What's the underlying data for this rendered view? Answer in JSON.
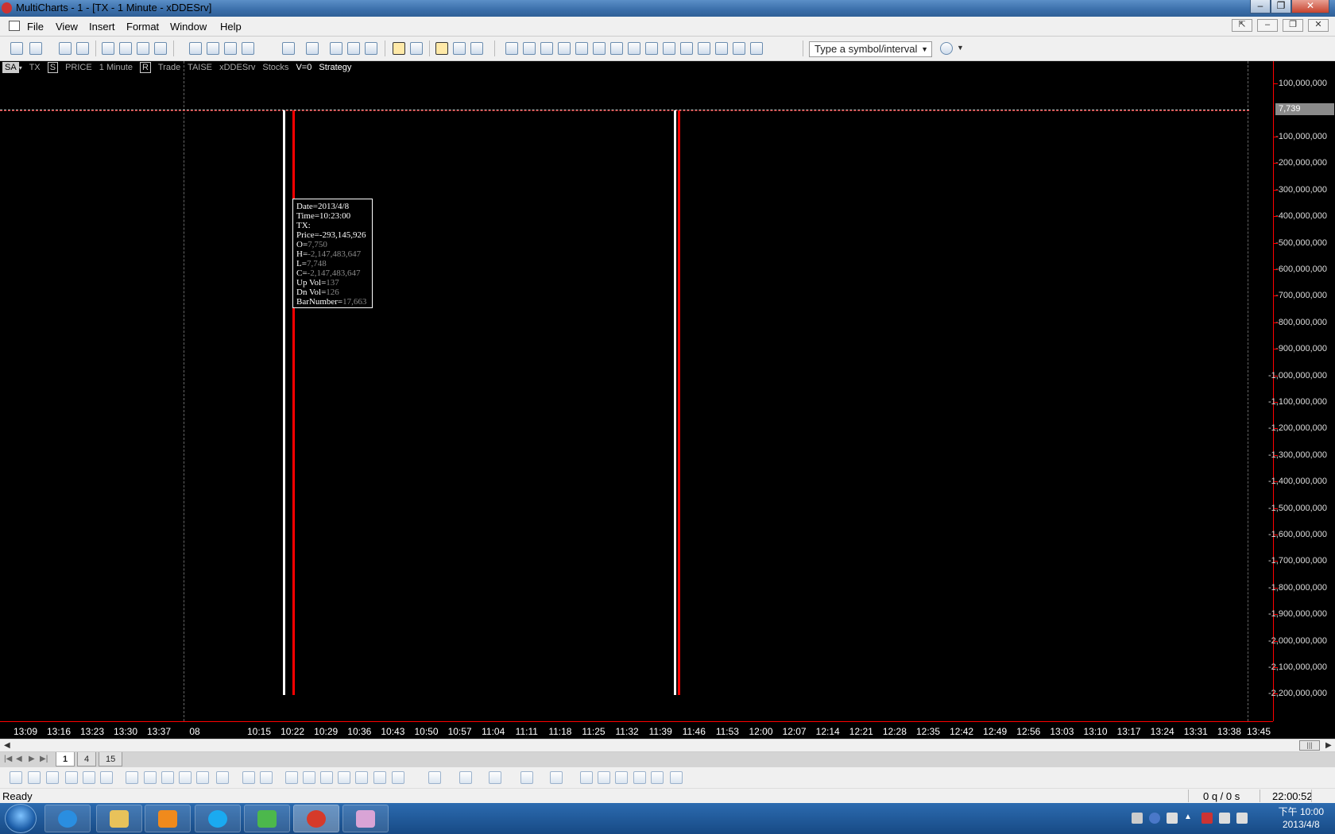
{
  "window": {
    "title": "MultiCharts - 1 - [TX - 1 Minute - xDDESrv]"
  },
  "menu": {
    "items": [
      "File",
      "View",
      "Insert",
      "Format",
      "Window",
      "Help"
    ]
  },
  "toolbar": {
    "symbol_placeholder": "Type a symbol/interval"
  },
  "chart_header": {
    "sa": "SA",
    "symbol": "TX",
    "s": "S",
    "field": "PRICE",
    "interval": "1 Minute",
    "r": "R",
    "data_type": "Trade",
    "exchange": "TAISE",
    "source": "xDDESrv",
    "category": "Stocks",
    "volume": "V=0",
    "strategy": "Strategy"
  },
  "tooltip": {
    "date_label": "Date=",
    "date": "2013/4/8",
    "time_label": "Time=",
    "time": "10:23:00",
    "symbol_line": "TX:",
    "price_label": "Price=",
    "price": "-293,145,926",
    "o_label": "O=",
    "o": "7,750",
    "h_label": "H=",
    "h": "-2,147,483,647",
    "l_label": "L=",
    "l": "7,748",
    "c_label": "C=",
    "c": "-2,147,483,647",
    "upvol_label": "Up Vol=",
    "upvol": "137",
    "dnvol_label": "Dn Vol=",
    "dnvol": "126",
    "barnum_label": "BarNumber=",
    "barnum": "17,663"
  },
  "price_axis": {
    "current_price": "7,739",
    "labels": [
      "100,000,000",
      "-100,000,000",
      "-200,000,000",
      "-300,000,000",
      "-400,000,000",
      "-500,000,000",
      "-600,000,000",
      "-700,000,000",
      "-800,000,000",
      "-900,000,000",
      "-1,000,000,000",
      "-1,100,000,000",
      "-1,200,000,000",
      "-1,300,000,000",
      "-1,400,000,000",
      "-1,500,000,000",
      "-1,600,000,000",
      "-1,700,000,000",
      "-1,800,000,000",
      "-1,900,000,000",
      "-2,000,000,000",
      "-2,100,000,000",
      "-2,200,000,000"
    ]
  },
  "time_axis": {
    "labels": [
      "13:09",
      "13:16",
      "13:23",
      "13:30",
      "13:37",
      "08",
      "10:15",
      "10:22",
      "10:29",
      "10:36",
      "10:43",
      "10:50",
      "10:57",
      "11:04",
      "11:11",
      "11:18",
      "11:25",
      "11:32",
      "11:39",
      "11:46",
      "11:53",
      "12:00",
      "12:07",
      "12:14",
      "12:21",
      "12:28",
      "12:35",
      "12:42",
      "12:49",
      "12:56",
      "13:03",
      "13:10",
      "13:17",
      "13:24",
      "13:31",
      "13:38",
      "13:45"
    ]
  },
  "sheet_tabs": [
    "1",
    "4",
    "15"
  ],
  "status": {
    "text": "Ready",
    "quotes": "0 q / 0 s",
    "time": "22:00:52"
  },
  "taskbar": {
    "clock_time": "下午 10:00",
    "clock_date": "2013/4/8"
  },
  "colors": {
    "chart_bg": "#000000",
    "bar_up": "#ffffff",
    "bar_down": "#ff0000",
    "axis": "#ff0000"
  }
}
